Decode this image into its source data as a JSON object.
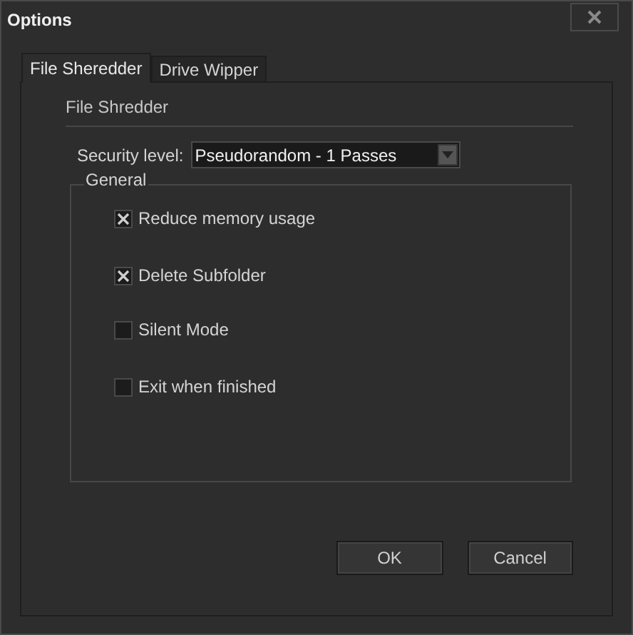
{
  "window": {
    "title": "Options"
  },
  "tabs": [
    {
      "label": "File Sheredder",
      "selected": true
    },
    {
      "label": "Drive Wipper",
      "selected": false
    }
  ],
  "section_title": "File Shredder",
  "security": {
    "label": "Security level:",
    "value": "Pseudorandom - 1 Passes"
  },
  "group": {
    "title": "General",
    "options": [
      {
        "label": "Reduce memory usage",
        "checked": true
      },
      {
        "label": "Delete Subfolder",
        "checked": true
      },
      {
        "label": "Silent Mode",
        "checked": false
      },
      {
        "label": "Exit when finished",
        "checked": false
      }
    ]
  },
  "buttons": [
    "OK",
    "Cancel"
  ]
}
